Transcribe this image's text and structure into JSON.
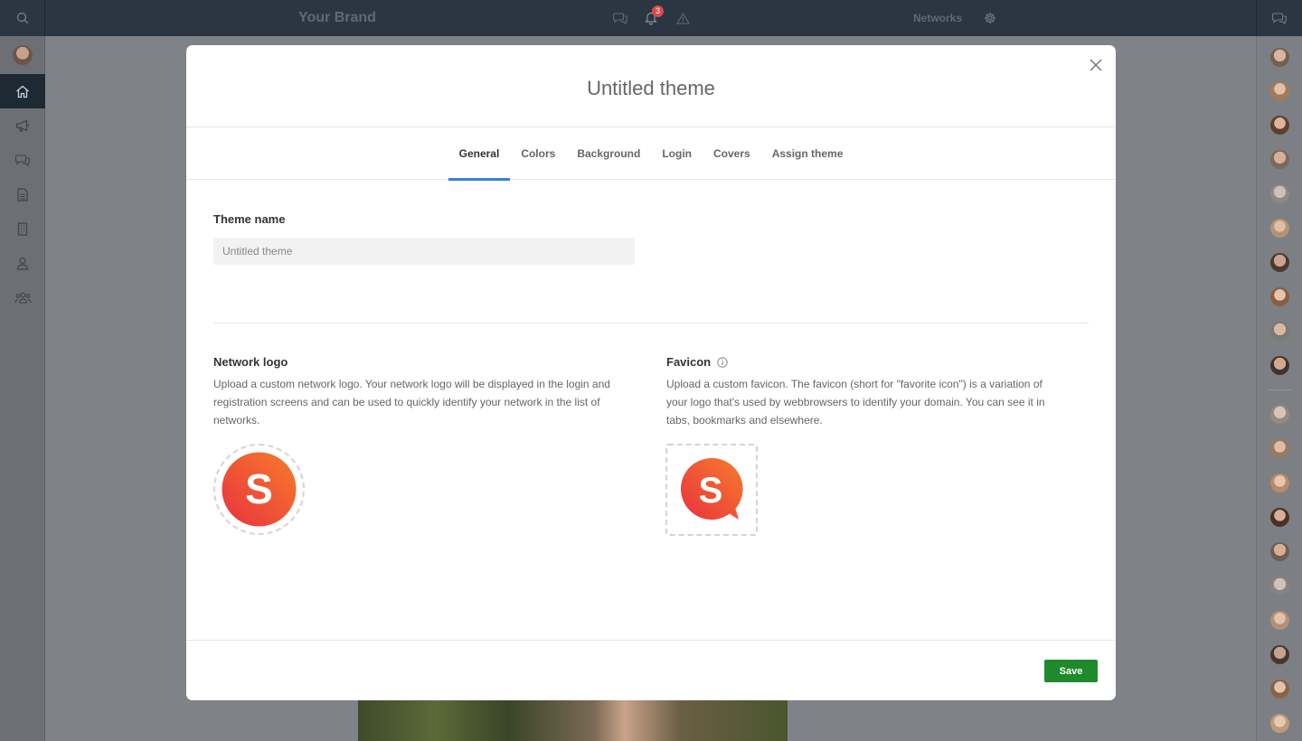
{
  "topbar": {
    "brand": "Your Brand",
    "notification_count": "3",
    "networks_label": "Networks",
    "icons": [
      "search-icon",
      "chat-bubbles-icon",
      "bell-icon",
      "warning-icon",
      "gear-icon",
      "chat-icon"
    ]
  },
  "leftbar": {
    "items": [
      "home-icon",
      "megaphone-icon",
      "chat-bubbles-icon",
      "document-icon",
      "building-icon",
      "person-icon",
      "group-icon"
    ],
    "active": "home-icon"
  },
  "modal": {
    "title": "Untitled theme",
    "tabs": [
      {
        "label": "General",
        "active": true
      },
      {
        "label": "Colors",
        "active": false
      },
      {
        "label": "Background",
        "active": false
      },
      {
        "label": "Login",
        "active": false
      },
      {
        "label": "Covers",
        "active": false
      },
      {
        "label": "Assign theme",
        "active": false
      }
    ],
    "theme_name": {
      "label": "Theme name",
      "placeholder": "Untitled theme",
      "value": ""
    },
    "network_logo": {
      "label": "Network logo",
      "description": "Upload a custom network logo. Your network logo will be displayed in the login and registration screens and can be used to quickly identify your network in the list of networks.",
      "logo_letter": "S"
    },
    "favicon": {
      "label": "Favicon",
      "description": "Upload a custom favicon. The favicon (short for \"favorite icon\") is a variation of your logo that's used by webbrowsers to identify your domain. You can see it in tabs, bookmarks and elsewhere.",
      "logo_letter": "S"
    },
    "save_label": "Save"
  },
  "colors": {
    "accent": "#3d7fd3",
    "save": "#1f8a2c",
    "logo_gradient_start": "#e8323f",
    "logo_gradient_end": "#f77c2a"
  }
}
